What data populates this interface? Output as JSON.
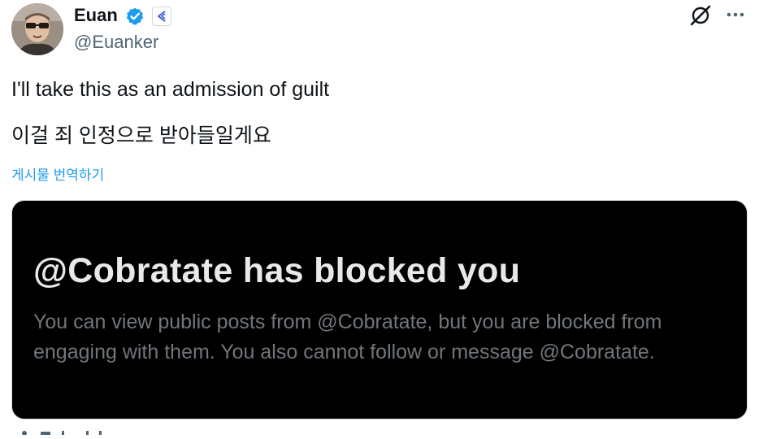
{
  "author": {
    "name": "Euan",
    "handle": "@Euanker",
    "verified_color": "#1d9bf0",
    "avatar_icon": "profile-photo"
  },
  "tweet": {
    "line1": "I'll take this as an admission of guilt",
    "line2": "이걸 죄 인정으로 받아들일게요",
    "translate_label": "게시물 번역하기"
  },
  "media": {
    "title": "@Cobratate has blocked you",
    "description": "You can view public posts from @Cobratate, but you are blocked from engaging with them. You also cannot follow or message @Cobratate."
  },
  "icons": {
    "grok": "grok-icon",
    "more": "more-icon",
    "verified": "verified-badge-icon",
    "affiliate": "affiliate-badge-icon"
  },
  "colors": {
    "accent": "#1d9bf0",
    "text": "#0f1419",
    "muted": "#536471",
    "media_bg": "#000000"
  }
}
